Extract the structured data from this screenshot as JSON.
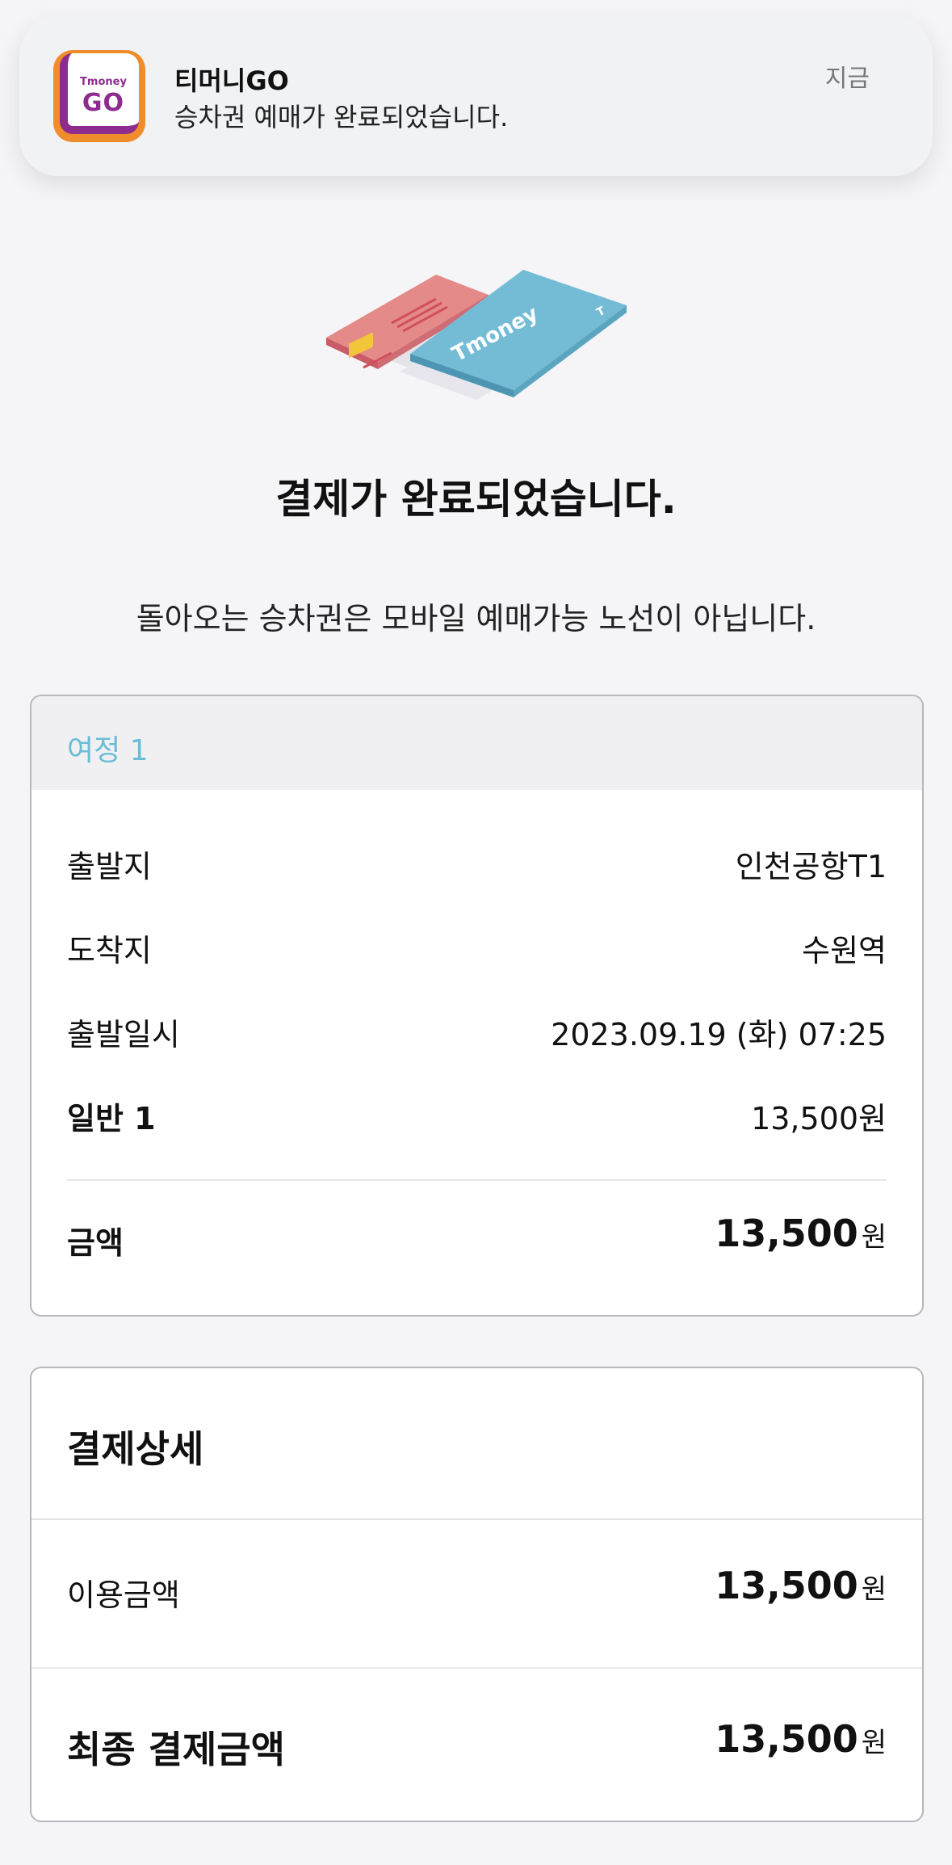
{
  "notification": {
    "app_icon_text_small": "Tmoney",
    "app_icon_text_large": "GO",
    "title": "티머니GO",
    "message": "승차권 예매가 완료되었습니다.",
    "time": "지금"
  },
  "illustration": {
    "card_text": "Tmoney",
    "card_mark": "T"
  },
  "headline": "결제가 완료되었습니다.",
  "notice": "돌아오는 승차권은 모바일 예매가능 노선이 아닙니다.",
  "journey": {
    "label": "여정 1",
    "rows": [
      {
        "label": "출발지",
        "value": "인천공항T1"
      },
      {
        "label": "도착지",
        "value": "수원역"
      },
      {
        "label": "출발일시",
        "value": "2023.09.19 (화) 07:25"
      },
      {
        "label": "일반 1",
        "value": "13,500원"
      }
    ],
    "total_label": "금액",
    "total_value": "13,500",
    "total_unit": "원"
  },
  "payment_detail": {
    "title": "결제상세",
    "usage_label": "이용금액",
    "usage_value": "13,500",
    "usage_unit": "원",
    "final_label": "최종 결제금액",
    "final_value": "13,500",
    "final_unit": "원"
  },
  "colors": {
    "accent": "#6bbdd6",
    "brand_purple": "#8e2b8e",
    "brand_orange": "#ef8c2c"
  }
}
